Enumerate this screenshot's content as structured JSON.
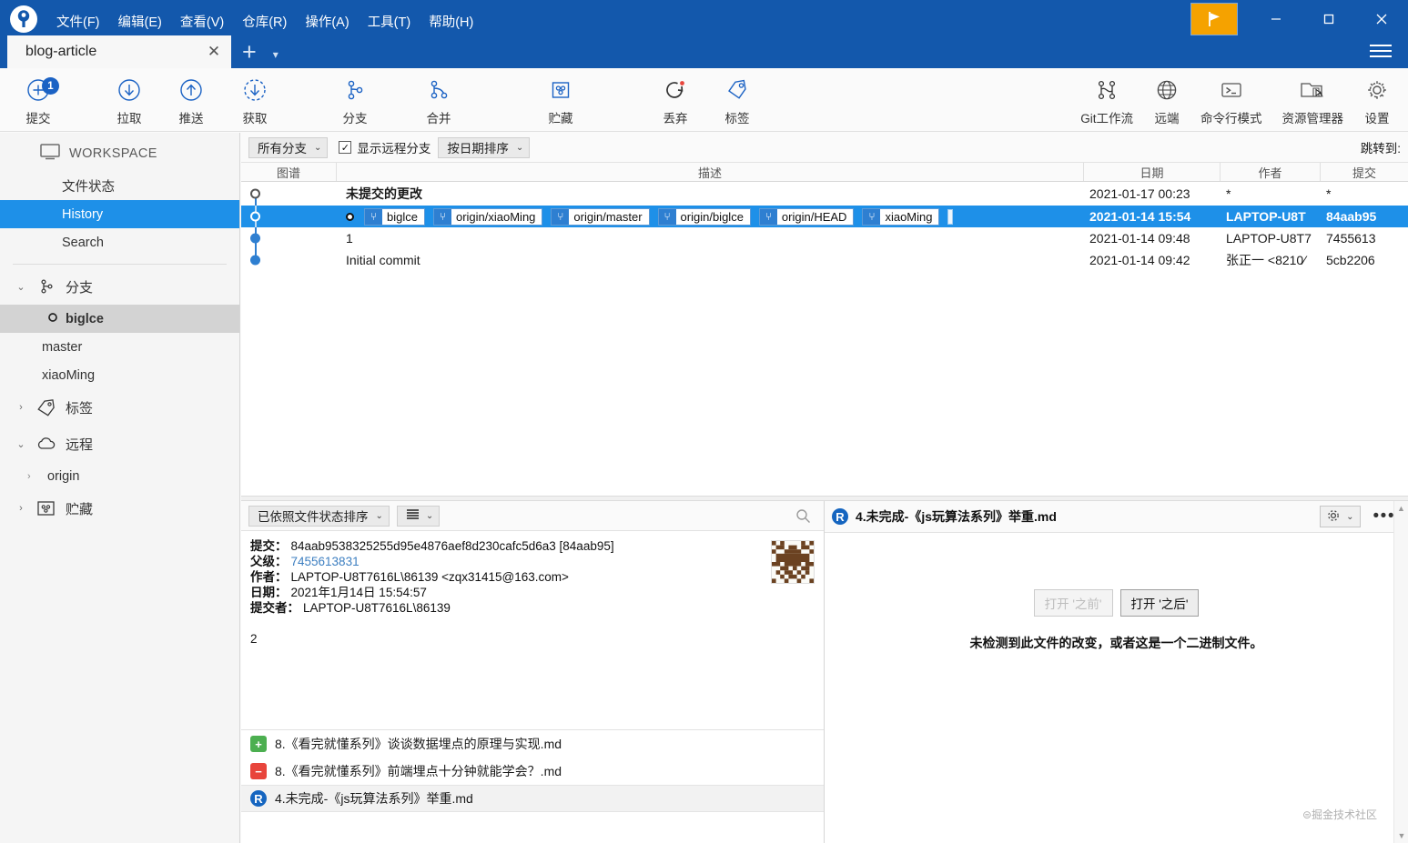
{
  "window": {
    "menu": [
      "文件(F)",
      "编辑(E)",
      "查看(V)",
      "仓库(R)",
      "操作(A)",
      "工具(T)",
      "帮助(H)"
    ],
    "minimize": "—",
    "maximize": "□",
    "close": "✕",
    "accent_color": "#1358ac",
    "flag_color": "#f5a200"
  },
  "tab": {
    "label": "blog-article",
    "close": "✕",
    "add": "+",
    "caret": "▾"
  },
  "toolbar": {
    "left": [
      {
        "label": "提交",
        "icon": "commit-plus-icon",
        "badge": "1"
      },
      {
        "label": "拉取",
        "icon": "pull-down-arrow-icon"
      },
      {
        "label": "推送",
        "icon": "push-up-arrow-icon"
      },
      {
        "label": "获取",
        "icon": "fetch-dashed-arrow-icon"
      },
      {
        "label": "分支",
        "icon": "branch-icon"
      },
      {
        "label": "合并",
        "icon": "merge-icon"
      },
      {
        "label": "贮藏",
        "icon": "stash-box-icon"
      },
      {
        "label": "丢弃",
        "icon": "discard-revert-icon"
      },
      {
        "label": "标签",
        "icon": "tag-icon"
      }
    ],
    "right": [
      {
        "label": "Git工作流",
        "icon": "gitflow-icon"
      },
      {
        "label": "远端",
        "icon": "globe-icon"
      },
      {
        "label": "命令行模式",
        "icon": "terminal-icon"
      },
      {
        "label": "资源管理器",
        "icon": "folder-explorer-icon"
      },
      {
        "label": "设置",
        "icon": "gear-icon"
      }
    ]
  },
  "sidebar": {
    "workspace_label": "WORKSPACE",
    "workspace_items": [
      {
        "label": "文件状态",
        "state": "normal"
      },
      {
        "label": "History",
        "state": "active"
      },
      {
        "label": "Search",
        "state": "normal"
      }
    ],
    "groups": [
      {
        "label": "分支",
        "icon": "branch-icon",
        "expanded": true,
        "chevron": "⌄",
        "children": [
          {
            "label": "biglce",
            "state": "selected",
            "bullet": "○"
          },
          {
            "label": "master",
            "state": "normal"
          },
          {
            "label": "xiaoMing",
            "state": "normal"
          }
        ]
      },
      {
        "label": "标签",
        "icon": "tag-icon",
        "expanded": false,
        "chevron": "›",
        "children": []
      },
      {
        "label": "远程",
        "icon": "cloud-icon",
        "expanded": true,
        "chevron": "⌄",
        "children": [
          {
            "label": "origin",
            "state": "normal",
            "chevron": "›"
          }
        ]
      },
      {
        "label": "贮藏",
        "icon": "stash-box-icon",
        "expanded": false,
        "chevron": "›",
        "children": []
      }
    ]
  },
  "history": {
    "branch_filter": "所有分支",
    "show_remote_label": "显示远程分支",
    "show_remote_checked": true,
    "sort_mode": "按日期排序",
    "jump_to_label": "跳转到:",
    "columns": [
      "图谱",
      "描述",
      "日期",
      "作者",
      "提交"
    ],
    "rows": [
      {
        "description": "未提交的更改",
        "date": "2021-01-17 00:23",
        "author": "*",
        "commit": "*",
        "selected": false,
        "bold": true,
        "node": "hollow",
        "refs": []
      },
      {
        "description": "",
        "date": "2021-01-14 15:54",
        "author": "LAPTOP-U8T",
        "commit": "84aab95",
        "selected": true,
        "bold": true,
        "node": "hollow-sel",
        "refs": [
          "biglce",
          "origin/xiaoMing",
          "origin/master",
          "origin/biglce",
          "origin/HEAD",
          "xiaoMing"
        ]
      },
      {
        "description": "1",
        "date": "2021-01-14 09:48",
        "author": "LAPTOP-U8T7",
        "commit": "7455613",
        "selected": false,
        "bold": false,
        "node": "fill",
        "refs": []
      },
      {
        "description": "Initial commit",
        "date": "2021-01-14 09:42",
        "author": "张正一 <8210⁄",
        "commit": "5cb2206",
        "selected": false,
        "bold": false,
        "node": "fill",
        "refs": []
      }
    ]
  },
  "commit_detail": {
    "sort_label": "已依照文件状态排序",
    "list_icon": "list-lines-icon",
    "search_icon": "search-icon",
    "fields": [
      {
        "key": "提交：",
        "value": "84aab9538325255d95e4876aef8d230cafc5d6a3 [84aab95]",
        "link": false
      },
      {
        "key": "父级：",
        "value": "7455613831",
        "link": true
      },
      {
        "key": "作者：",
        "value": "LAPTOP-U8T7616L\\86139 <zqx31415@163.com>",
        "link": false
      },
      {
        "key": "日期：",
        "value": "2021年1月14日 15:54:57",
        "link": false
      },
      {
        "key": "提交者：",
        "value": "LAPTOP-U8T7616L\\86139",
        "link": false
      }
    ],
    "message": "2",
    "files": [
      {
        "name": "8.《看完就懂系列》谈谈数据埋点的原理与实现.md",
        "status": "+",
        "status_color": "#4caf50",
        "selected": false
      },
      {
        "name": "8.《看完就懂系列》前端埋点十分钟就能学会？.md",
        "status": "−",
        "status_color": "#e8453c",
        "selected": false
      },
      {
        "name": "4.未完成-《js玩算法系列》举重.md",
        "status": "R",
        "status_color": "#1565c0",
        "selected": true
      }
    ]
  },
  "diff_panel": {
    "title": "4.未完成-《js玩算法系列》举重.md",
    "title_status": "R",
    "title_status_color": "#1565c0",
    "gear_icon": "gear-icon",
    "gear_caret": "⌄",
    "more_icon": "more-dots-icon",
    "button_before": "打开 '之前'",
    "button_after": "打开 '之后'",
    "before_enabled": false,
    "after_enabled": true,
    "note": "未检测到此文件的改变，或者这是一个二进制文件。",
    "watermark": "⊜掘金技术社区"
  }
}
